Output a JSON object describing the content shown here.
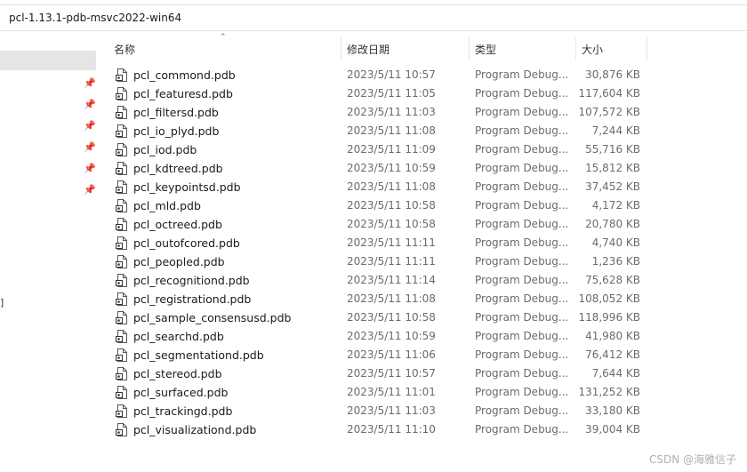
{
  "address_bar": {
    "path": "pcl-1.13.1-pdb-msvc2022-win64"
  },
  "columns": {
    "name": "名称",
    "date": "修改日期",
    "type": "类型",
    "size": "大小"
  },
  "nav": {
    "bracket": "]"
  },
  "files": [
    {
      "name": "pcl_commond.pdb",
      "date": "2023/5/11 10:57",
      "type": "Program Debug...",
      "size": "30,876 KB"
    },
    {
      "name": "pcl_featuresd.pdb",
      "date": "2023/5/11 11:05",
      "type": "Program Debug...",
      "size": "117,604 KB"
    },
    {
      "name": "pcl_filtersd.pdb",
      "date": "2023/5/11 11:03",
      "type": "Program Debug...",
      "size": "107,572 KB"
    },
    {
      "name": "pcl_io_plyd.pdb",
      "date": "2023/5/11 11:08",
      "type": "Program Debug...",
      "size": "7,244 KB"
    },
    {
      "name": "pcl_iod.pdb",
      "date": "2023/5/11 11:09",
      "type": "Program Debug...",
      "size": "55,716 KB"
    },
    {
      "name": "pcl_kdtreed.pdb",
      "date": "2023/5/11 10:59",
      "type": "Program Debug...",
      "size": "15,812 KB"
    },
    {
      "name": "pcl_keypointsd.pdb",
      "date": "2023/5/11 11:08",
      "type": "Program Debug...",
      "size": "37,452 KB"
    },
    {
      "name": "pcl_mld.pdb",
      "date": "2023/5/11 10:58",
      "type": "Program Debug...",
      "size": "4,172 KB"
    },
    {
      "name": "pcl_octreed.pdb",
      "date": "2023/5/11 10:58",
      "type": "Program Debug...",
      "size": "20,780 KB"
    },
    {
      "name": "pcl_outofcored.pdb",
      "date": "2023/5/11 11:11",
      "type": "Program Debug...",
      "size": "4,740 KB"
    },
    {
      "name": "pcl_peopled.pdb",
      "date": "2023/5/11 11:11",
      "type": "Program Debug...",
      "size": "1,236 KB"
    },
    {
      "name": "pcl_recognitiond.pdb",
      "date": "2023/5/11 11:14",
      "type": "Program Debug...",
      "size": "75,628 KB"
    },
    {
      "name": "pcl_registrationd.pdb",
      "date": "2023/5/11 11:08",
      "type": "Program Debug...",
      "size": "108,052 KB"
    },
    {
      "name": "pcl_sample_consensusd.pdb",
      "date": "2023/5/11 10:58",
      "type": "Program Debug...",
      "size": "118,996 KB"
    },
    {
      "name": "pcl_searchd.pdb",
      "date": "2023/5/11 10:59",
      "type": "Program Debug...",
      "size": "41,980 KB"
    },
    {
      "name": "pcl_segmentationd.pdb",
      "date": "2023/5/11 11:06",
      "type": "Program Debug...",
      "size": "76,412 KB"
    },
    {
      "name": "pcl_stereod.pdb",
      "date": "2023/5/11 10:57",
      "type": "Program Debug...",
      "size": "7,644 KB"
    },
    {
      "name": "pcl_surfaced.pdb",
      "date": "2023/5/11 11:01",
      "type": "Program Debug...",
      "size": "131,252 KB"
    },
    {
      "name": "pcl_trackingd.pdb",
      "date": "2023/5/11 11:03",
      "type": "Program Debug...",
      "size": "33,180 KB"
    },
    {
      "name": "pcl_visualizationd.pdb",
      "date": "2023/5/11 11:10",
      "type": "Program Debug...",
      "size": "39,004 KB"
    }
  ],
  "watermark": "CSDN @海雅信子"
}
